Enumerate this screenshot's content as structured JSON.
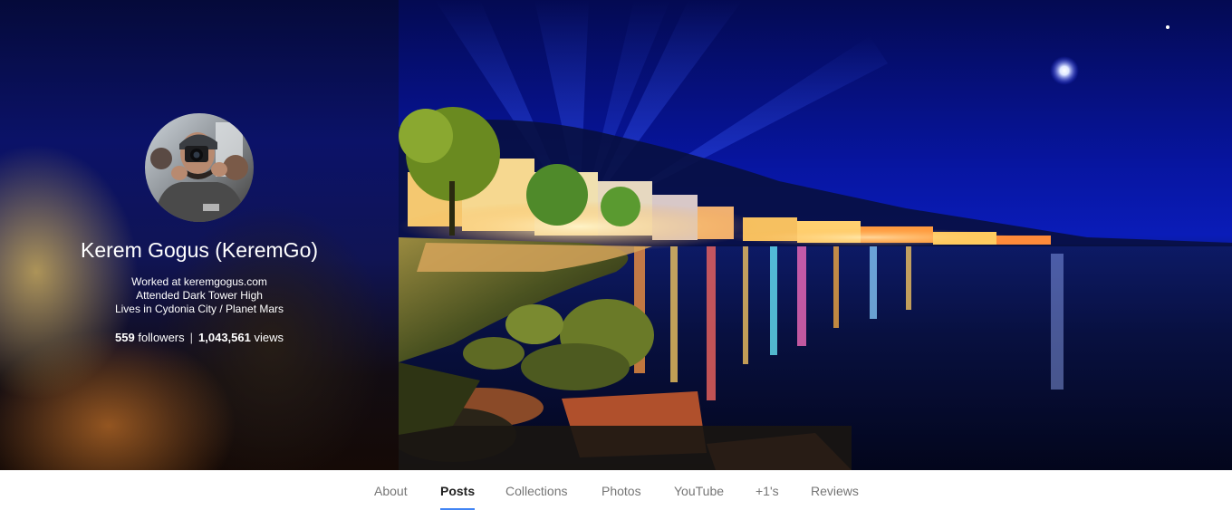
{
  "profile": {
    "name": "Kerem Gogus (KeremGo)",
    "work": "Worked at keremgogus.com",
    "education": "Attended Dark Tower High",
    "location": "Lives in Cydonia City / Planet Mars",
    "followers_count": "559",
    "followers_label": "followers",
    "separator": "|",
    "views_count": "1,043,561",
    "views_label": "views"
  },
  "tabs": [
    {
      "label": "About",
      "active": false
    },
    {
      "label": "Posts",
      "active": true
    },
    {
      "label": "Collections",
      "active": false
    },
    {
      "label": "Photos",
      "active": false
    },
    {
      "label": "YouTube",
      "active": false
    },
    {
      "label": "+1's",
      "active": false
    },
    {
      "label": "Reviews",
      "active": false
    }
  ],
  "colors": {
    "tab_active_underline": "#4285f4",
    "tab_active_text": "#212121",
    "tab_inactive_text": "#757575"
  }
}
